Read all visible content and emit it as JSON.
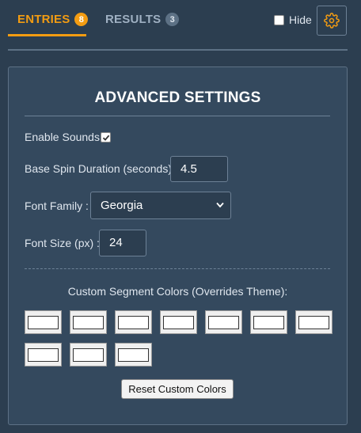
{
  "tabs": [
    {
      "label": "ENTRIES",
      "count": "8",
      "active": true
    },
    {
      "label": "RESULTS",
      "count": "3",
      "active": false
    }
  ],
  "hide": {
    "label": "Hide",
    "checked": false
  },
  "settings_icon": "gear-icon",
  "panel": {
    "title": "ADVANCED SETTINGS",
    "enable_sounds": {
      "label": "Enable Sounds :",
      "checked": true
    },
    "spin_duration": {
      "label": "Base Spin Duration (seconds) :",
      "value": "4.5"
    },
    "font_family": {
      "label": "Font Family :",
      "value": "Georgia"
    },
    "font_size": {
      "label": "Font Size (px) :",
      "value": "24"
    },
    "custom_colors": {
      "label": "Custom Segment Colors (Overrides Theme):",
      "count": 10
    },
    "reset_label": "Reset Custom Colors"
  },
  "colors": {
    "accent": "#f39c12",
    "background": "#2c3e50",
    "panel": "#34495e"
  }
}
